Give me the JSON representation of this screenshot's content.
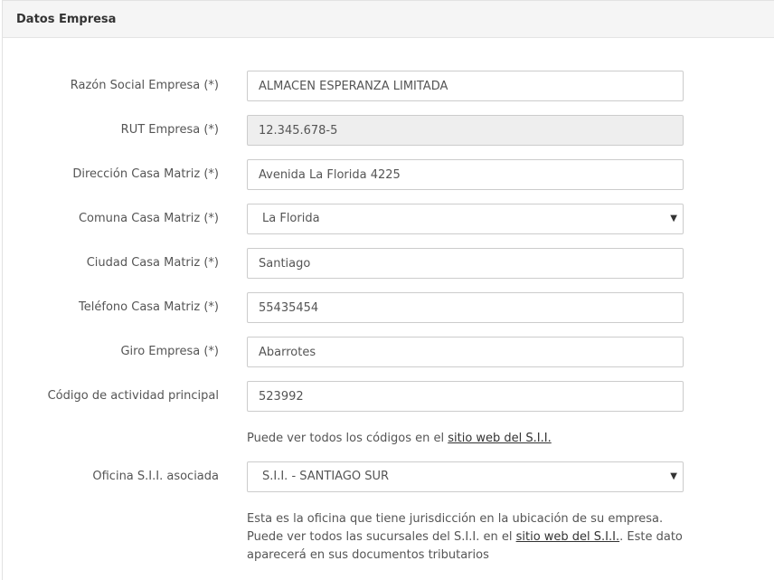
{
  "panel": {
    "title": "Datos Empresa"
  },
  "fields": {
    "razon_social": {
      "label": "Razón Social Empresa (*)",
      "value": "ALMACEN ESPERANZA LIMITADA"
    },
    "rut": {
      "label": "RUT Empresa (*)",
      "value": "12.345.678-5"
    },
    "direccion": {
      "label": "Dirección Casa Matriz (*)",
      "value": "Avenida La Florida 4225"
    },
    "comuna": {
      "label": "Comuna Casa Matriz (*)",
      "value": "La Florida"
    },
    "ciudad": {
      "label": "Ciudad Casa Matriz (*)",
      "value": "Santiago"
    },
    "telefono": {
      "label": "Teléfono Casa Matriz (*)",
      "value": "55435454"
    },
    "giro": {
      "label": "Giro Empresa (*)",
      "value": "Abarrotes"
    },
    "codigo": {
      "label": "Código de actividad principal",
      "value": "523992"
    },
    "oficina": {
      "label": "Oficina S.I.I. asociada",
      "value": "S.I.I. - SANTIAGO SUR"
    }
  },
  "help": {
    "codigo_pre": "Puede ver todos los códigos en el ",
    "codigo_link": "sitio web del S.I.I.",
    "oficina_pre": "Esta es la oficina que tiene jurisdicción en la ubicación de su empresa. Puede ver todos las sucursales del S.I.I. en el ",
    "oficina_link": "sitio web del S.I.I.",
    "oficina_post": ". Este dato aparecerá en sus documentos tributarios"
  },
  "icons": {
    "select_caret": "caret-down-icon"
  }
}
